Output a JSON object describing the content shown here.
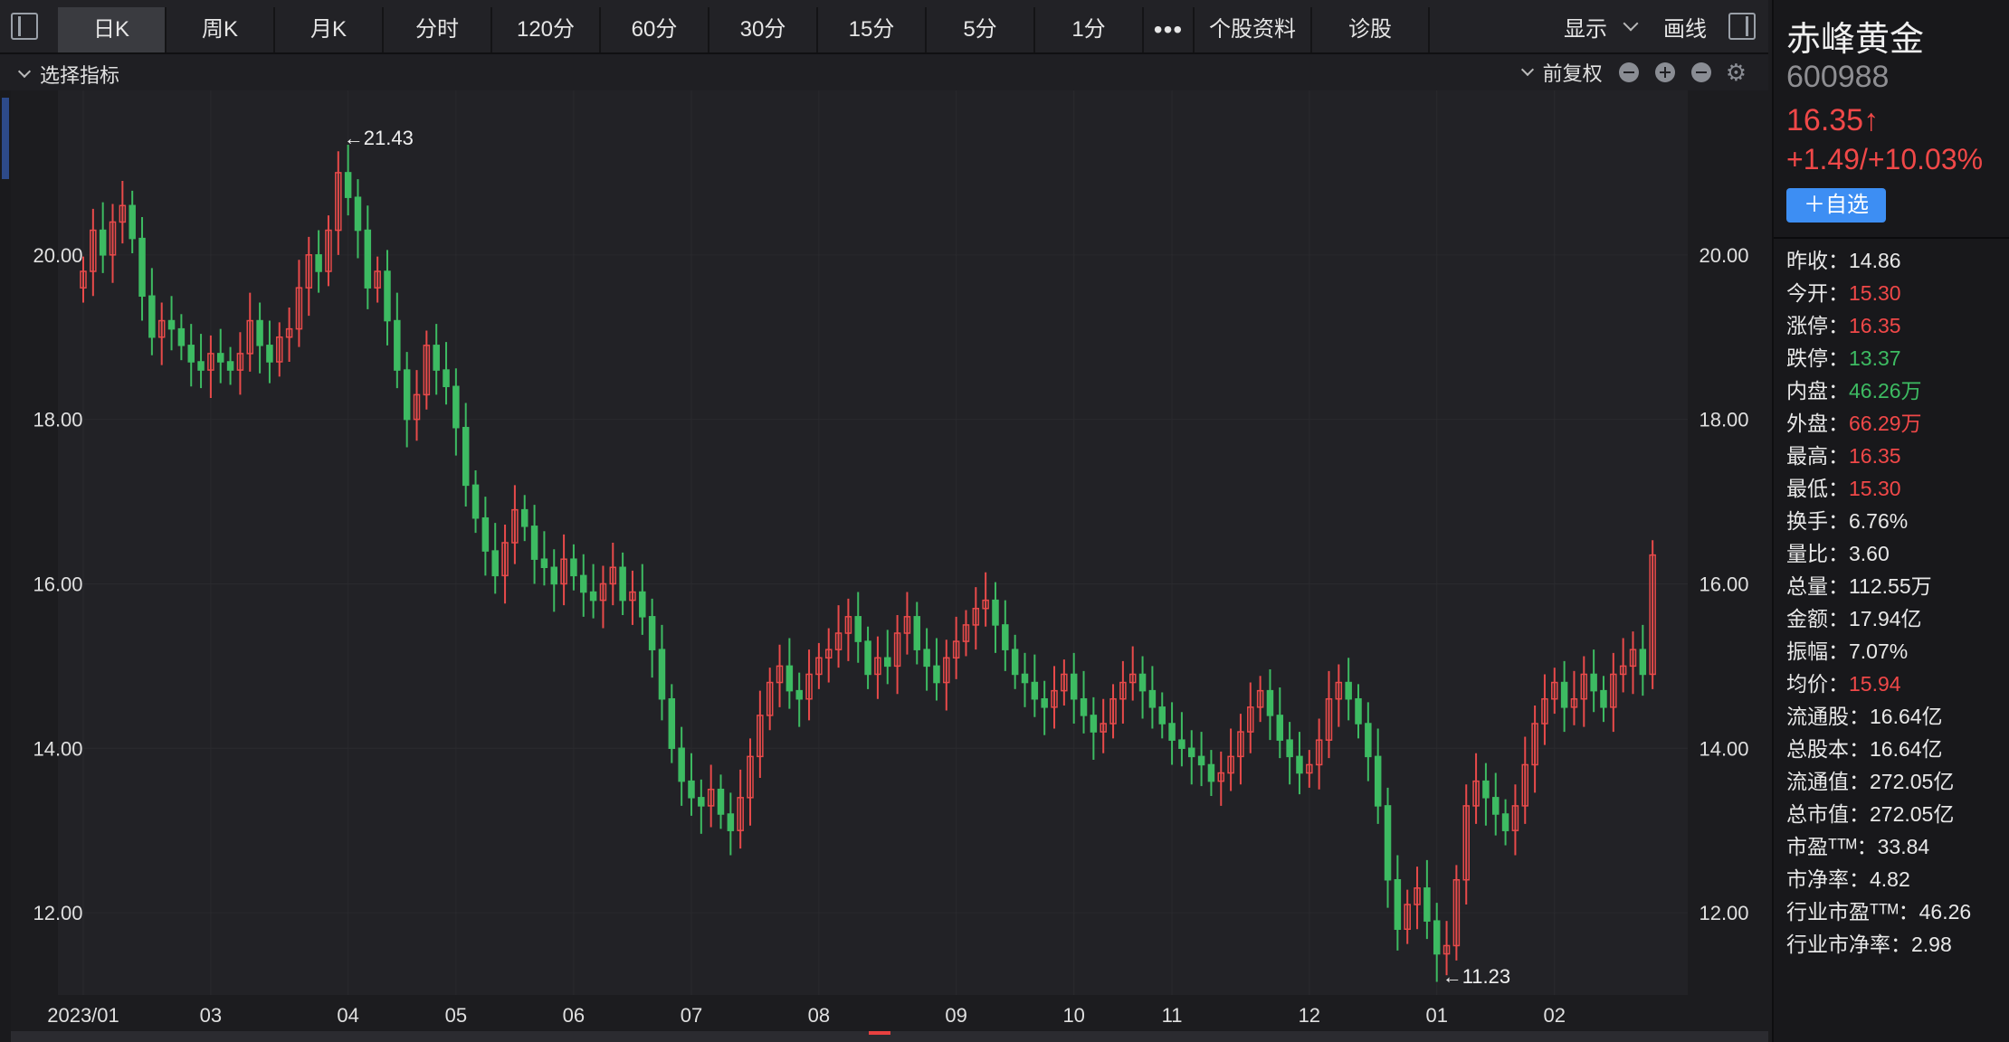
{
  "toolbar": {
    "tabs": [
      {
        "label": "日K",
        "active": true
      },
      {
        "label": "周K"
      },
      {
        "label": "月K"
      },
      {
        "label": "分时"
      },
      {
        "label": "120分"
      },
      {
        "label": "60分"
      },
      {
        "label": "30分"
      },
      {
        "label": "15分"
      },
      {
        "label": "5分"
      },
      {
        "label": "1分"
      }
    ],
    "more": "•••",
    "profile": "个股资料",
    "diagnose": "诊股",
    "display": "显示",
    "draw": "画线"
  },
  "indicator_bar": {
    "select": "选择指标",
    "adjust": "前复权",
    "gear_icon": "gear-icon"
  },
  "stock": {
    "name": "赤峰黄金",
    "code": "600988",
    "price": "16.35↑",
    "change": "+1.49/+10.03%",
    "add_label": "＋自选"
  },
  "stats": [
    {
      "label": "昨收：",
      "value": "14.86",
      "color": "white"
    },
    {
      "label": "今开：",
      "value": "15.30",
      "color": "red"
    },
    {
      "label": "涨停：",
      "value": "16.35",
      "color": "red"
    },
    {
      "label": "跌停：",
      "value": "13.37",
      "color": "green"
    },
    {
      "label": "内盘：",
      "value": "46.26万",
      "color": "green"
    },
    {
      "label": "外盘：",
      "value": "66.29万",
      "color": "red"
    },
    {
      "label": "最高：",
      "value": "16.35",
      "color": "red"
    },
    {
      "label": "最低：",
      "value": "15.30",
      "color": "red"
    },
    {
      "label": "换手：",
      "value": "6.76%",
      "color": "white"
    },
    {
      "label": "量比：",
      "value": "3.60",
      "color": "white"
    },
    {
      "label": "总量：",
      "value": "112.55万",
      "color": "white"
    },
    {
      "label": "金额：",
      "value": "17.94亿",
      "color": "white"
    },
    {
      "label": "振幅：",
      "value": "7.07%",
      "color": "white"
    },
    {
      "label": "均价：",
      "value": "15.94",
      "color": "red"
    },
    {
      "label": "流通股：",
      "value": "16.64亿",
      "color": "white"
    },
    {
      "label": "总股本：",
      "value": "16.64亿",
      "color": "white"
    },
    {
      "label": "流通值：",
      "value": "272.05亿",
      "color": "white"
    },
    {
      "label": "总市值：",
      "value": "272.05亿",
      "color": "white"
    },
    {
      "label": "市盈ᵀᵀᴹ：",
      "value": "33.84",
      "color": "white"
    },
    {
      "label": "市净率：",
      "value": "4.82",
      "color": "white"
    },
    {
      "label": "行业市盈ᵀᵀᴹ：",
      "value": "46.26",
      "color": "white"
    },
    {
      "label": "行业市净率：",
      "value": "2.98",
      "color": "white"
    }
  ],
  "colors": {
    "up": "#e84a4a",
    "down": "#3dbb62",
    "grid": "#2a2a2e",
    "axis_text": "#e0e0e0"
  },
  "chart_data": {
    "type": "candlestick",
    "ylim": [
      11.0,
      22.0
    ],
    "y_ticks": [
      "12.00",
      "14.00",
      "16.00",
      "18.00",
      "20.00"
    ],
    "x_ticks": [
      "2023/01",
      "03",
      "04",
      "05",
      "06",
      "07",
      "08",
      "09",
      "10",
      "11",
      "12",
      "01",
      "02"
    ],
    "annotations": [
      {
        "text": "←21.43",
        "value": 21.43
      },
      {
        "text": "←11.23",
        "value": 11.23
      }
    ],
    "closes": [
      19.8,
      20.3,
      20.0,
      20.4,
      20.6,
      20.2,
      19.5,
      19.0,
      19.2,
      19.1,
      18.9,
      18.7,
      18.6,
      18.8,
      18.7,
      18.6,
      18.8,
      19.2,
      18.9,
      18.7,
      19.0,
      19.1,
      19.6,
      20.0,
      19.8,
      20.3,
      21.0,
      20.7,
      20.3,
      19.6,
      19.8,
      19.2,
      18.6,
      18.0,
      18.3,
      18.9,
      18.6,
      18.4,
      17.9,
      17.2,
      16.8,
      16.4,
      16.1,
      16.5,
      16.9,
      16.7,
      16.3,
      16.2,
      16.0,
      16.3,
      16.1,
      15.9,
      15.8,
      16.0,
      16.2,
      15.8,
      15.9,
      15.6,
      15.2,
      14.6,
      14.0,
      13.6,
      13.4,
      13.3,
      13.5,
      13.2,
      13.0,
      13.4,
      13.9,
      14.4,
      14.8,
      15.0,
      14.7,
      14.6,
      14.9,
      15.1,
      15.2,
      15.4,
      15.6,
      15.3,
      14.9,
      15.1,
      15.0,
      15.4,
      15.6,
      15.2,
      15.0,
      14.8,
      15.1,
      15.3,
      15.5,
      15.7,
      15.8,
      15.5,
      15.2,
      14.9,
      14.8,
      14.6,
      14.5,
      14.7,
      14.9,
      14.6,
      14.4,
      14.2,
      14.3,
      14.6,
      14.8,
      14.9,
      14.7,
      14.5,
      14.3,
      14.1,
      14.0,
      13.9,
      13.8,
      13.6,
      13.7,
      13.9,
      14.2,
      14.5,
      14.7,
      14.4,
      14.1,
      13.9,
      13.7,
      13.8,
      14.1,
      14.6,
      14.8,
      14.6,
      14.3,
      13.9,
      13.3,
      12.4,
      11.8,
      12.1,
      12.3,
      11.9,
      11.5,
      11.6,
      12.4,
      13.3,
      13.6,
      13.4,
      13.2,
      13.0,
      13.3,
      13.8,
      14.3,
      14.6,
      14.8,
      14.5,
      14.6,
      14.9,
      14.7,
      14.5,
      14.9,
      15.0,
      15.2,
      14.9,
      16.35
    ]
  }
}
